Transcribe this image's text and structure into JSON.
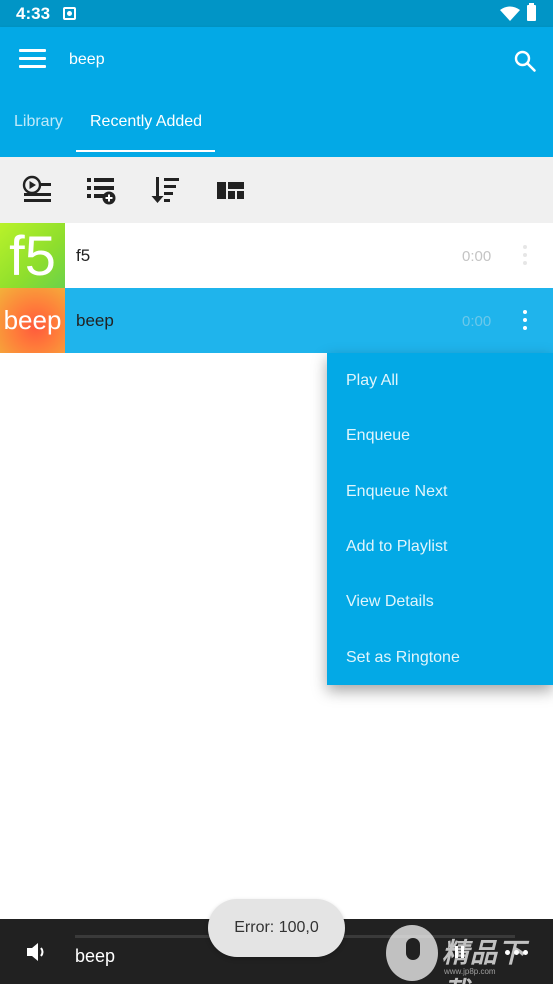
{
  "status_bar": {
    "time": "4:33",
    "icons": [
      "notification-icon",
      "wifi-icon",
      "battery-icon"
    ]
  },
  "app_bar": {
    "title": "beep",
    "menu_icon": "hamburger-menu-icon",
    "search_icon": "search-icon"
  },
  "tabs": [
    {
      "label": "Library",
      "selected": false
    },
    {
      "label": "Recently Added",
      "selected": true
    }
  ],
  "toolbar": {
    "icons": [
      "play-list-icon",
      "add-to-playlist-icon",
      "sort-icon",
      "grid-layout-icon"
    ]
  },
  "tracks": [
    {
      "thumb_text": "f5",
      "title": "f5",
      "duration": "0:00",
      "selected": false
    },
    {
      "thumb_text": "beep",
      "title": "beep",
      "duration": "0:00",
      "selected": true
    }
  ],
  "context_menu": {
    "items": [
      "Play All",
      "Enqueue",
      "Enqueue Next",
      "Add to Playlist",
      "View Details",
      "Set as Ringtone"
    ]
  },
  "player": {
    "title": "beep",
    "icons": [
      "volume-icon",
      "pause-icon",
      "more-icon"
    ]
  },
  "toast": {
    "message": "Error: 100,0"
  },
  "watermark": {
    "text": "精品下载",
    "url": "www.jp8p.com"
  },
  "colors": {
    "primary": "#03a9e6",
    "primary_dark": "#0195c6",
    "selected_row": "#1fb4ec",
    "player_bar": "#212121",
    "toolbar_bg": "#f0f0f0"
  }
}
